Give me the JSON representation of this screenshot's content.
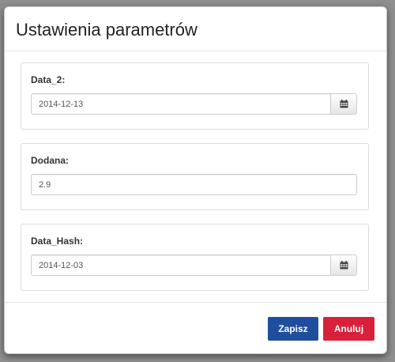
{
  "dialog": {
    "title": "Ustawienia parametrów"
  },
  "fields": [
    {
      "label": "Data_2:",
      "value": "2014-12-13",
      "has_calendar": true
    },
    {
      "label": "Dodana:",
      "value": "2.9",
      "has_calendar": false
    },
    {
      "label": "Data_Hash:",
      "value": "2014-12-03",
      "has_calendar": true
    }
  ],
  "footer": {
    "save_label": "Zapisz",
    "cancel_label": "Anuluj"
  },
  "colors": {
    "save_button": "#1f4e9c",
    "cancel_button": "#d9203a"
  },
  "icons": {
    "calendar": "calendar-icon"
  }
}
